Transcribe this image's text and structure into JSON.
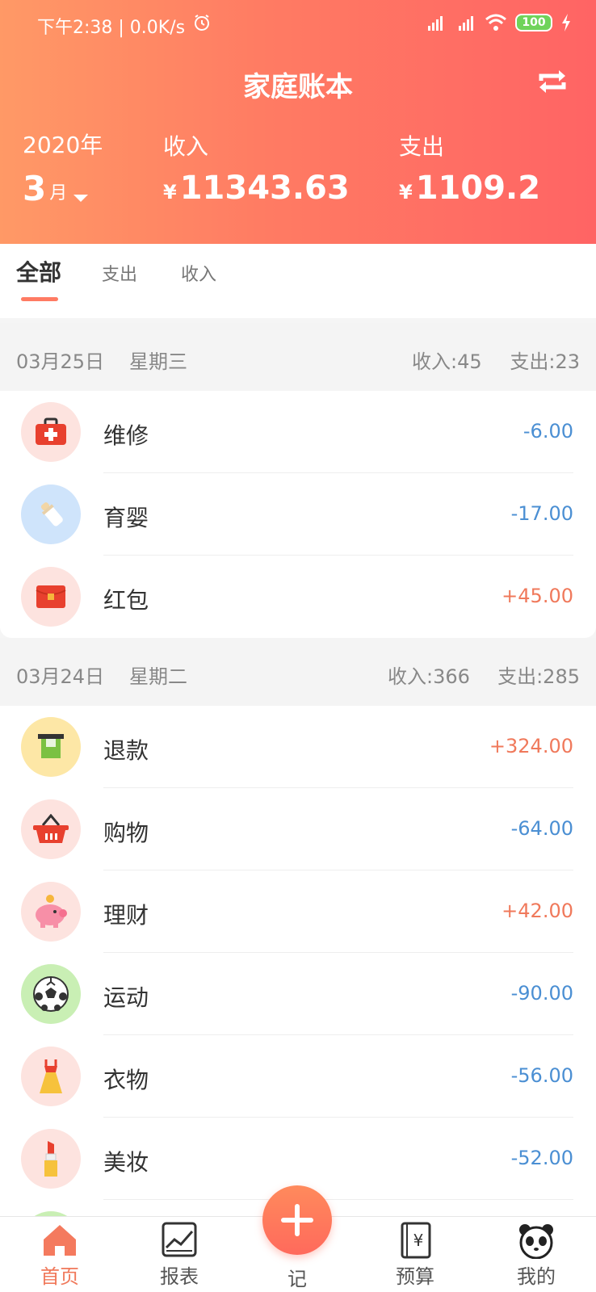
{
  "status": {
    "time": "下午2:38 | 0.0K/s",
    "battery": "100"
  },
  "header": {
    "title": "家庭账本",
    "year": "2020年",
    "month_num": "3",
    "month_unit": "月",
    "income_label": "收入",
    "income_value": "11343.63",
    "expense_label": "支出",
    "expense_value": "1109.2",
    "currency": "¥"
  },
  "tabs": [
    "全部",
    "支出",
    "收入"
  ],
  "days": [
    {
      "date": "03月25日",
      "weekday": "星期三",
      "income": "收入:45",
      "expense": "支出:23",
      "items": [
        {
          "name": "维修",
          "amount": "-6.00",
          "icon": "first-aid-kit-icon",
          "bg": "#fde3df"
        },
        {
          "name": "育婴",
          "amount": "-17.00",
          "icon": "baby-bottle-icon",
          "bg": "#cfe4fb"
        },
        {
          "name": "红包",
          "amount": "+45.00",
          "icon": "red-envelope-icon",
          "bg": "#fde3df"
        }
      ]
    },
    {
      "date": "03月24日",
      "weekday": "星期二",
      "income": "收入:366",
      "expense": "支出:285",
      "items": [
        {
          "name": "退款",
          "amount": "+324.00",
          "icon": "refund-icon",
          "bg": "#fde7a6"
        },
        {
          "name": "购物",
          "amount": "-64.00",
          "icon": "shopping-basket-icon",
          "bg": "#fde3df"
        },
        {
          "name": "理财",
          "amount": "+42.00",
          "icon": "piggy-bank-icon",
          "bg": "#fde3df"
        },
        {
          "name": "运动",
          "amount": "-90.00",
          "icon": "soccer-ball-icon",
          "bg": "#c9efb4"
        },
        {
          "name": "衣物",
          "amount": "-56.00",
          "icon": "dress-icon",
          "bg": "#fde3df"
        },
        {
          "name": "美妆",
          "amount": "-52.00",
          "icon": "lipstick-icon",
          "bg": "#fde3df"
        }
      ]
    }
  ],
  "nav": {
    "home": "首页",
    "report": "报表",
    "add": "记",
    "budget": "预算",
    "mine": "我的"
  },
  "colors": {
    "accent": "#ff7b63",
    "expense": "#4b8fd3",
    "income": "#f0795b"
  }
}
